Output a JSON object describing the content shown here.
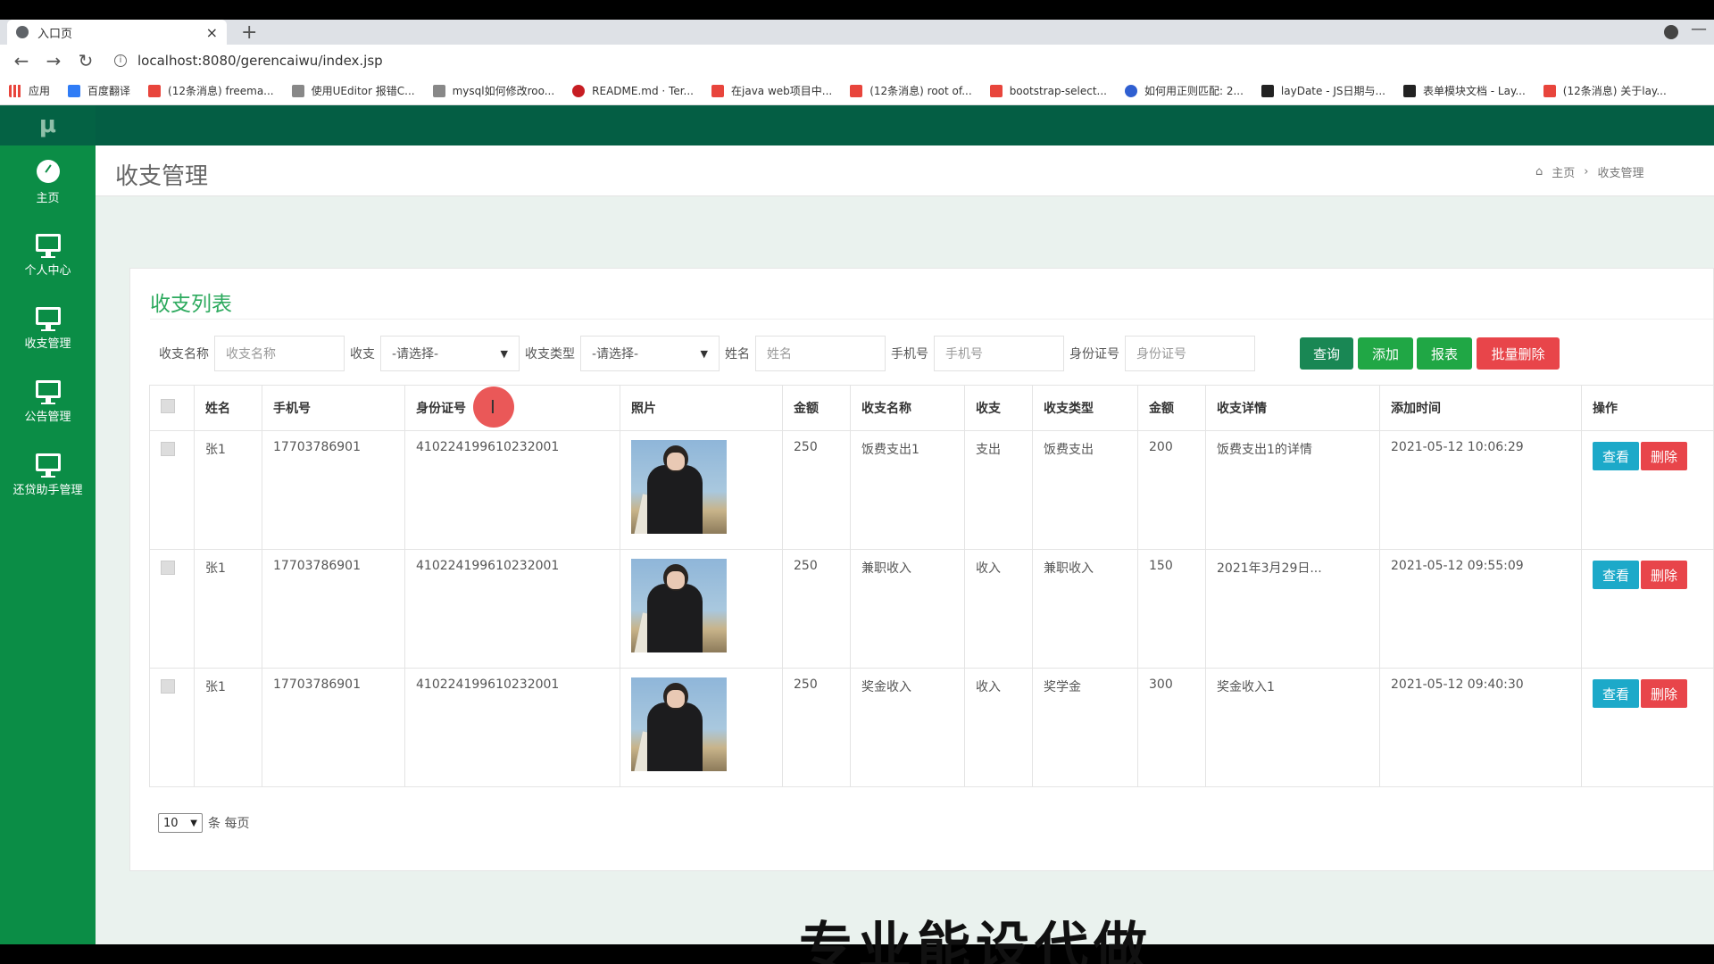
{
  "browser": {
    "tab_title": "入口页",
    "url": "localhost:8080/gerencaiwu/index.jsp",
    "bookmarks": [
      {
        "label": "应用",
        "color": "#e8453c"
      },
      {
        "label": "百度翻译",
        "color": "#2f7cf6"
      },
      {
        "label": "(12条消息) freema...",
        "color": "#e8453c"
      },
      {
        "label": "使用UEditor 报错C...",
        "color": "#555555"
      },
      {
        "label": "mysql如何修改roo...",
        "color": "#555555"
      },
      {
        "label": "README.md · Ter...",
        "color": "#c71d23"
      },
      {
        "label": "在java web项目中...",
        "color": "#e8453c"
      },
      {
        "label": "(12条消息) root of...",
        "color": "#e8453c"
      },
      {
        "label": "bootstrap-select...",
        "color": "#e8453c"
      },
      {
        "label": "如何用正则匹配: 2...",
        "color": "#2f5fd1"
      },
      {
        "label": "layDate - JS日期与...",
        "color": "#222222"
      },
      {
        "label": "表单模块文档 - Lay...",
        "color": "#222222"
      },
      {
        "label": "(12条消息) 关于lay...",
        "color": "#e8453c"
      }
    ]
  },
  "sidebar": {
    "logo": "μ",
    "items": [
      {
        "label": "主页",
        "icon": "dashboard-icon"
      },
      {
        "label": "个人中心",
        "icon": "monitor-icon"
      },
      {
        "label": "收支管理",
        "icon": "monitor-icon"
      },
      {
        "label": "公告管理",
        "icon": "monitor-icon"
      },
      {
        "label": "还贷助手管理",
        "icon": "monitor-icon"
      }
    ]
  },
  "header": {
    "title": "收支管理",
    "breadcrumb_home": "主页",
    "breadcrumb_sep": "›",
    "breadcrumb_current": "收支管理"
  },
  "panel": {
    "title": "收支列表"
  },
  "filter": {
    "name_label": "收支名称",
    "name_placeholder": "收支名称",
    "type_label": "收支",
    "type_value": "-请选择-",
    "category_label": "收支类型",
    "category_value": "-请选择-",
    "person_label": "姓名",
    "person_placeholder": "姓名",
    "phone_label": "手机号",
    "phone_placeholder": "手机号",
    "id_label": "身份证号",
    "id_placeholder": "身份证号",
    "query": "查询",
    "add": "添加",
    "report": "报表",
    "batch_delete": "批量删除"
  },
  "colors": {
    "query": "#198754",
    "add": "#20a745",
    "report": "#20a745",
    "batch_delete": "#e8454a"
  },
  "table": {
    "headers": [
      "姓名",
      "手机号",
      "身份证号",
      "照片",
      "金额",
      "收支名称",
      "收支",
      "收支类型",
      "金额",
      "收支详情",
      "添加时间",
      "操作"
    ],
    "rows": [
      {
        "name": "张1",
        "phone": "17703786901",
        "id": "410224199610232001",
        "amount": "250",
        "item": "饭费支出1",
        "type": "支出",
        "category": "饭费支出",
        "amount2": "200",
        "detail": "饭费支出1的详情",
        "time": "2021-05-12 10:06:29"
      },
      {
        "name": "张1",
        "phone": "17703786901",
        "id": "410224199610232001",
        "amount": "250",
        "item": "兼职收入",
        "type": "收入",
        "category": "兼职收入",
        "amount2": "150",
        "detail": "2021年3月29日...",
        "time": "2021-05-12 09:55:09"
      },
      {
        "name": "张1",
        "phone": "17703786901",
        "id": "410224199610232001",
        "amount": "250",
        "item": "奖金收入",
        "type": "收入",
        "category": "奖学金",
        "amount2": "300",
        "detail": "奖金收入1",
        "time": "2021-05-12 09:40:30"
      }
    ],
    "view_label": "查看",
    "delete_label": "删除"
  },
  "pager": {
    "page_size": "10",
    "suffix": "条 每页"
  },
  "overlay_caption": "专业能设代做"
}
